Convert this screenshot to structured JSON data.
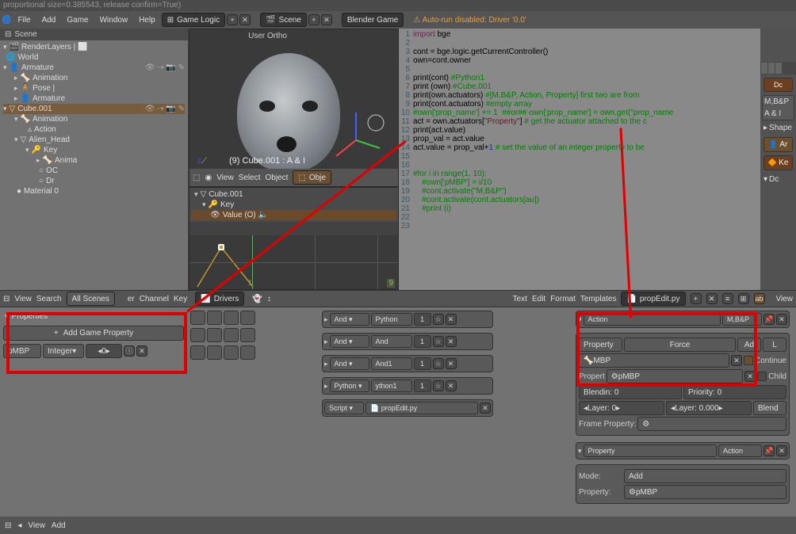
{
  "topbar": "proportional size=0.385543, release confirm=True)",
  "menu": {
    "items": [
      "File",
      "Add",
      "Game",
      "Window",
      "Help"
    ],
    "layout": "Game Logic",
    "scene": "Scene",
    "engine": "Blender Game",
    "warn": "Auto-run disabled: Driver '0.0'"
  },
  "outliner": {
    "title": "Scene",
    "rows": [
      {
        "ind": 0,
        "tri": "▾",
        "icon": "🎬",
        "label": "RenderLayers | ⬜"
      },
      {
        "ind": 0,
        "tri": "",
        "icon": "🌐",
        "label": "World"
      },
      {
        "ind": 0,
        "tri": "▾",
        "icon": "👤",
        "label": "Armature",
        "restrict": true,
        "sel": false
      },
      {
        "ind": 1,
        "tri": "▸",
        "icon": "🦴",
        "label": "Animation"
      },
      {
        "ind": 1,
        "tri": "▸",
        "icon": "🧍",
        "label": "Pose |"
      },
      {
        "ind": 1,
        "tri": "▸",
        "icon": "👤",
        "label": "Armature"
      },
      {
        "ind": 0,
        "tri": "▾",
        "icon": "▽",
        "label": "Cube.001",
        "restrict": true,
        "sel": true
      },
      {
        "ind": 1,
        "tri": "▾",
        "icon": "🦴",
        "label": "Animation"
      },
      {
        "ind": 2,
        "tri": "",
        "icon": "▵",
        "label": "Action"
      },
      {
        "ind": 1,
        "tri": "▾",
        "icon": "▽",
        "label": "Alien_Head"
      },
      {
        "ind": 2,
        "tri": "▾",
        "icon": "🔑",
        "label": "Key"
      },
      {
        "ind": 3,
        "tri": "▸",
        "icon": "🦴",
        "label": "Anima"
      },
      {
        "ind": 3,
        "tri": "",
        "icon": "○",
        "label": "OC"
      },
      {
        "ind": 3,
        "tri": "",
        "icon": "○",
        "label": "Dr"
      },
      {
        "ind": 1,
        "tri": "",
        "icon": "●",
        "label": "Material 0"
      }
    ]
  },
  "viewport": {
    "label": "User Ortho",
    "overlay": "(9) Cube.001 : A & I",
    "menu": [
      "View",
      "Select",
      "Object"
    ],
    "mode": "Obje"
  },
  "graph": {
    "obj": "Cube.001",
    "key": "Key",
    "channel": "Value (O)",
    "frames": [
      "1",
      "9"
    ],
    "menu": [
      "View",
      "Channel",
      "Key"
    ]
  },
  "code": {
    "lines": [
      {
        "n": 1,
        "t": "import bge",
        "cls": ""
      },
      {
        "n": 2,
        "t": ""
      },
      {
        "n": 3,
        "t": "cont = bge.logic.getCurrentController()"
      },
      {
        "n": 4,
        "t": "own=cont.owner"
      },
      {
        "n": 5,
        "t": ""
      },
      {
        "n": 6,
        "t": "print(cont) #Python1",
        "c": "#Python1"
      },
      {
        "n": 7,
        "t": "print (own) #Cube.001",
        "c": "#Cube.001"
      },
      {
        "n": 8,
        "t": "print(own.actuators) #[M,B&P, Action, Property] first two are from",
        "c": "#[M,B&P, Action, Property] first two are from"
      },
      {
        "n": 9,
        "t": "print(cont.actuators) #empty array",
        "c": "#empty array"
      },
      {
        "n": 10,
        "t": "#own['prop_name'] += 1  ##or## own['prop_name'] = own.get(\"prop_name",
        "all_c": true
      },
      {
        "n": 11,
        "t": "act = own.actuators[\"Property\"] # get the actuator attached to the c",
        "c": "# get the actuator attached to the c",
        "s": "\"Property\""
      },
      {
        "n": 12,
        "t": "print(act.value)"
      },
      {
        "n": 13,
        "t": "prop_val = act.value"
      },
      {
        "n": 14,
        "t": "act.value = prop_val+1 # set the value of an integer property to be ",
        "c": "# set the value of an integer property to be ",
        "num": "1"
      },
      {
        "n": 15,
        "t": ""
      },
      {
        "n": 16,
        "t": ""
      },
      {
        "n": 17,
        "t": "#for i in range(1, 10):",
        "all_c": true
      },
      {
        "n": 18,
        "t": "    #own['pMBP'] = i/10",
        "all_c": true
      },
      {
        "n": 19,
        "t": "    #cont.activate(\"M,B&P\")",
        "all_c": true
      },
      {
        "n": 20,
        "t": "    #cont.activate(cont.actuators[au])",
        "all_c": true
      },
      {
        "n": 21,
        "t": "    #print (i)",
        "all_c": true
      },
      {
        "n": 22,
        "t": ""
      },
      {
        "n": 23,
        "t": ""
      }
    ]
  },
  "texthdr": {
    "menu": [
      "Text",
      "Edit",
      "Format",
      "Templates"
    ],
    "file": "propEdit.py"
  },
  "right": {
    "items": [
      "Dc",
      "M,B&P",
      "A & I",
      "Shape",
      "Ar",
      "Ke",
      "Dc"
    ]
  },
  "logic_hdr": {
    "left": [
      "View",
      "Search"
    ],
    "scenes": "All Scenes",
    "mid": "er",
    "drivers": "Drivers"
  },
  "props": {
    "title": "Properties",
    "addbtn": "Add Game Property",
    "name": "pMBP",
    "type": "Integer",
    "value": "0"
  },
  "controllers": [
    {
      "type": "And",
      "name": "Python",
      "idx": "1"
    },
    {
      "type": "And",
      "name": "And",
      "idx": "1"
    },
    {
      "type": "And",
      "name": "And1",
      "idx": "1"
    },
    {
      "type": "Python",
      "name": "ython1",
      "idx": "1"
    },
    {
      "scriptmode": "Script",
      "script": "propEdit.py"
    }
  ],
  "actuators": {
    "main": {
      "type": "Action",
      "name": "M,B&P"
    },
    "row1": {
      "a": "Property",
      "b": "Force",
      "c": "Ad",
      "d": "L"
    },
    "row2": {
      "action": "MBP",
      "cont": "Continue"
    },
    "row3": {
      "label": "Propert",
      "val": "pMBP",
      "child": "Child"
    },
    "row4": {
      "blend": "Blendin: 0",
      "prio": "Priority: 0"
    },
    "row5": {
      "layer": "Layer: 0",
      "lw": "Layer: 0.000",
      "mode": "Blend"
    },
    "row6": {
      "label": "Frame Property:",
      "val": ""
    },
    "sub": {
      "type": "Property",
      "name": "Action"
    },
    "sub1": {
      "label": "Mode:",
      "val": "Add"
    },
    "sub2": {
      "label": "Property:",
      "val": "pMBP"
    }
  },
  "footer": {
    "menu": [
      "View",
      "Add"
    ]
  }
}
